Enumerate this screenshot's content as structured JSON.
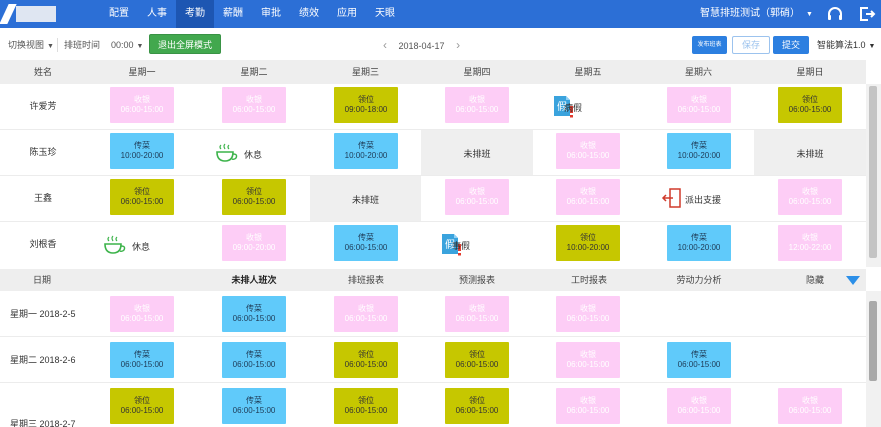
{
  "nav": {
    "items": [
      "配置",
      "人事",
      "考勤",
      "薪酬",
      "审批",
      "绩效",
      "应用",
      "天眼"
    ],
    "active_index": 2,
    "user": "智慧排班测试（郭硝）",
    "brand_color": "#2c6fd6"
  },
  "toolbar": {
    "switch_view": "切换视图",
    "shift_time_label": "排班时间",
    "shift_time_value": "00:00",
    "exit_fullscreen": "退出全屏模式",
    "date": "2018-04-17",
    "prev": "‹",
    "next": "›",
    "publish": "发布班表",
    "save": "保存",
    "submit": "提交",
    "algorithm": "智能算法1.0"
  },
  "schedule": {
    "columns": [
      "姓名",
      "星期一",
      "星期二",
      "星期三",
      "星期四",
      "星期五",
      "星期六",
      "星期日"
    ],
    "rows": [
      {
        "name": "许爱芳",
        "cells": [
          {
            "type": "shift",
            "color": "pink",
            "l1": "收银",
            "l2": "06:00-15:00"
          },
          {
            "type": "shift",
            "color": "pink",
            "l1": "收银",
            "l2": "06:00-15:00"
          },
          {
            "type": "shift",
            "color": "olive",
            "l1": "领位",
            "l2": "09:00-18:00"
          },
          {
            "type": "shift",
            "color": "pink",
            "l1": "收银",
            "l2": "06:00-15:00"
          },
          {
            "type": "leave",
            "icon": "假",
            "text": "病假"
          },
          {
            "type": "shift",
            "color": "pink",
            "l1": "收银",
            "l2": "06:00-15:00"
          },
          {
            "type": "shift",
            "color": "olive",
            "l1": "领位",
            "l2": "06:00-15:00"
          }
        ]
      },
      {
        "name": "陈玉珍",
        "cells": [
          {
            "type": "shift",
            "color": "blue",
            "l1": "传菜",
            "l2": "10:00-20:00"
          },
          {
            "type": "rest",
            "text": "休息"
          },
          {
            "type": "shift",
            "color": "blue",
            "l1": "传菜",
            "l2": "10:00-20:00"
          },
          {
            "type": "unscheduled",
            "text": "未排班"
          },
          {
            "type": "shift",
            "color": "pink",
            "l1": "收银",
            "l2": "06:00-15:00"
          },
          {
            "type": "shift",
            "color": "blue",
            "l1": "传菜",
            "l2": "10:00-20:00"
          },
          {
            "type": "unscheduled",
            "text": "未排班"
          }
        ]
      },
      {
        "name": "王鑫",
        "cells": [
          {
            "type": "shift",
            "color": "olive",
            "l1": "领位",
            "l2": "06:00-15:00"
          },
          {
            "type": "shift",
            "color": "olive",
            "l1": "领位",
            "l2": "06:00-15:00"
          },
          {
            "type": "unscheduled",
            "text": "未排班"
          },
          {
            "type": "shift",
            "color": "pink",
            "l1": "收银",
            "l2": "06:00-15:00"
          },
          {
            "type": "shift",
            "color": "pink",
            "l1": "收银",
            "l2": "06:00-15:00"
          },
          {
            "type": "support",
            "text": "派出支援"
          },
          {
            "type": "shift",
            "color": "pink",
            "l1": "收银",
            "l2": "06:00-15:00"
          }
        ]
      },
      {
        "name": "刘根香",
        "cells": [
          {
            "type": "rest",
            "text": "休息"
          },
          {
            "type": "shift",
            "color": "pink",
            "l1": "收银",
            "l2": "09:00-20:00"
          },
          {
            "type": "shift",
            "color": "blue",
            "l1": "传菜",
            "l2": "06:00-15:00"
          },
          {
            "type": "leave",
            "icon": "假",
            "text": "事假"
          },
          {
            "type": "shift",
            "color": "olive",
            "l1": "领位",
            "l2": "10:00-20:00"
          },
          {
            "type": "shift",
            "color": "blue",
            "l1": "传菜",
            "l2": "10:00-20:00"
          },
          {
            "type": "shift",
            "color": "pink",
            "l1": "收银",
            "l2": "12:00-22:00"
          }
        ]
      }
    ]
  },
  "bottom": {
    "tabs": [
      "日期",
      "未排人班次",
      "排班报表",
      "预测报表",
      "工时报表",
      "劳动力分析"
    ],
    "active_tab": 1,
    "hide": "隐藏",
    "rows": [
      {
        "date": "星期一  2018-2-5",
        "cells": [
          {
            "type": "shift",
            "color": "pink",
            "l1": "收银",
            "l2": "06:00-15:00"
          },
          {
            "type": "shift",
            "color": "blue",
            "l1": "传菜",
            "l2": "06:00-15:00"
          },
          {
            "type": "shift",
            "color": "pink",
            "l1": "收银",
            "l2": "06:00-15:00"
          },
          {
            "type": "shift",
            "color": "pink",
            "l1": "收银",
            "l2": "06:00-15:00"
          },
          {
            "type": "shift",
            "color": "pink",
            "l1": "收银",
            "l2": "06:00-15:00"
          },
          {
            "type": "empty"
          },
          {
            "type": "empty"
          }
        ]
      },
      {
        "date": "星期二  2018-2-6",
        "cells": [
          {
            "type": "shift",
            "color": "blue",
            "l1": "传菜",
            "l2": "06:00-15:00"
          },
          {
            "type": "shift",
            "color": "blue",
            "l1": "传菜",
            "l2": "06:00-15:00"
          },
          {
            "type": "shift",
            "color": "olive",
            "l1": "领位",
            "l2": "06:00-15:00"
          },
          {
            "type": "shift",
            "color": "olive",
            "l1": "领位",
            "l2": "06:00-15:00"
          },
          {
            "type": "shift",
            "color": "pink",
            "l1": "收银",
            "l2": "06:00-15:00"
          },
          {
            "type": "shift",
            "color": "blue",
            "l1": "传菜",
            "l2": "06:00-15:00"
          },
          {
            "type": "empty"
          }
        ]
      },
      {
        "date": "星期三  2018-2-7",
        "cells": [
          {
            "type": "shift",
            "color": "olive",
            "l1": "领位",
            "l2": "06:00-15:00"
          },
          {
            "type": "shift",
            "color": "blue",
            "l1": "传菜",
            "l2": "06:00-15:00"
          },
          {
            "type": "shift",
            "color": "olive",
            "l1": "领位",
            "l2": "06:00-15:00"
          },
          {
            "type": "shift",
            "color": "olive",
            "l1": "领位",
            "l2": "06:00-15:00"
          },
          {
            "type": "shift",
            "color": "pink",
            "l1": "收银",
            "l2": "06:00-15:00"
          },
          {
            "type": "shift",
            "color": "pink",
            "l1": "收银",
            "l2": "06:00-15:00"
          },
          {
            "type": "shift",
            "color": "pink",
            "l1": "收银",
            "l2": "06:00-15:00"
          }
        ]
      }
    ]
  },
  "colors": {
    "pink": "#fdcdf6",
    "blue": "#60cafa",
    "olive": "#c6c700",
    "green_button": "#42a84e",
    "blue_button": "#2c7fe0"
  }
}
